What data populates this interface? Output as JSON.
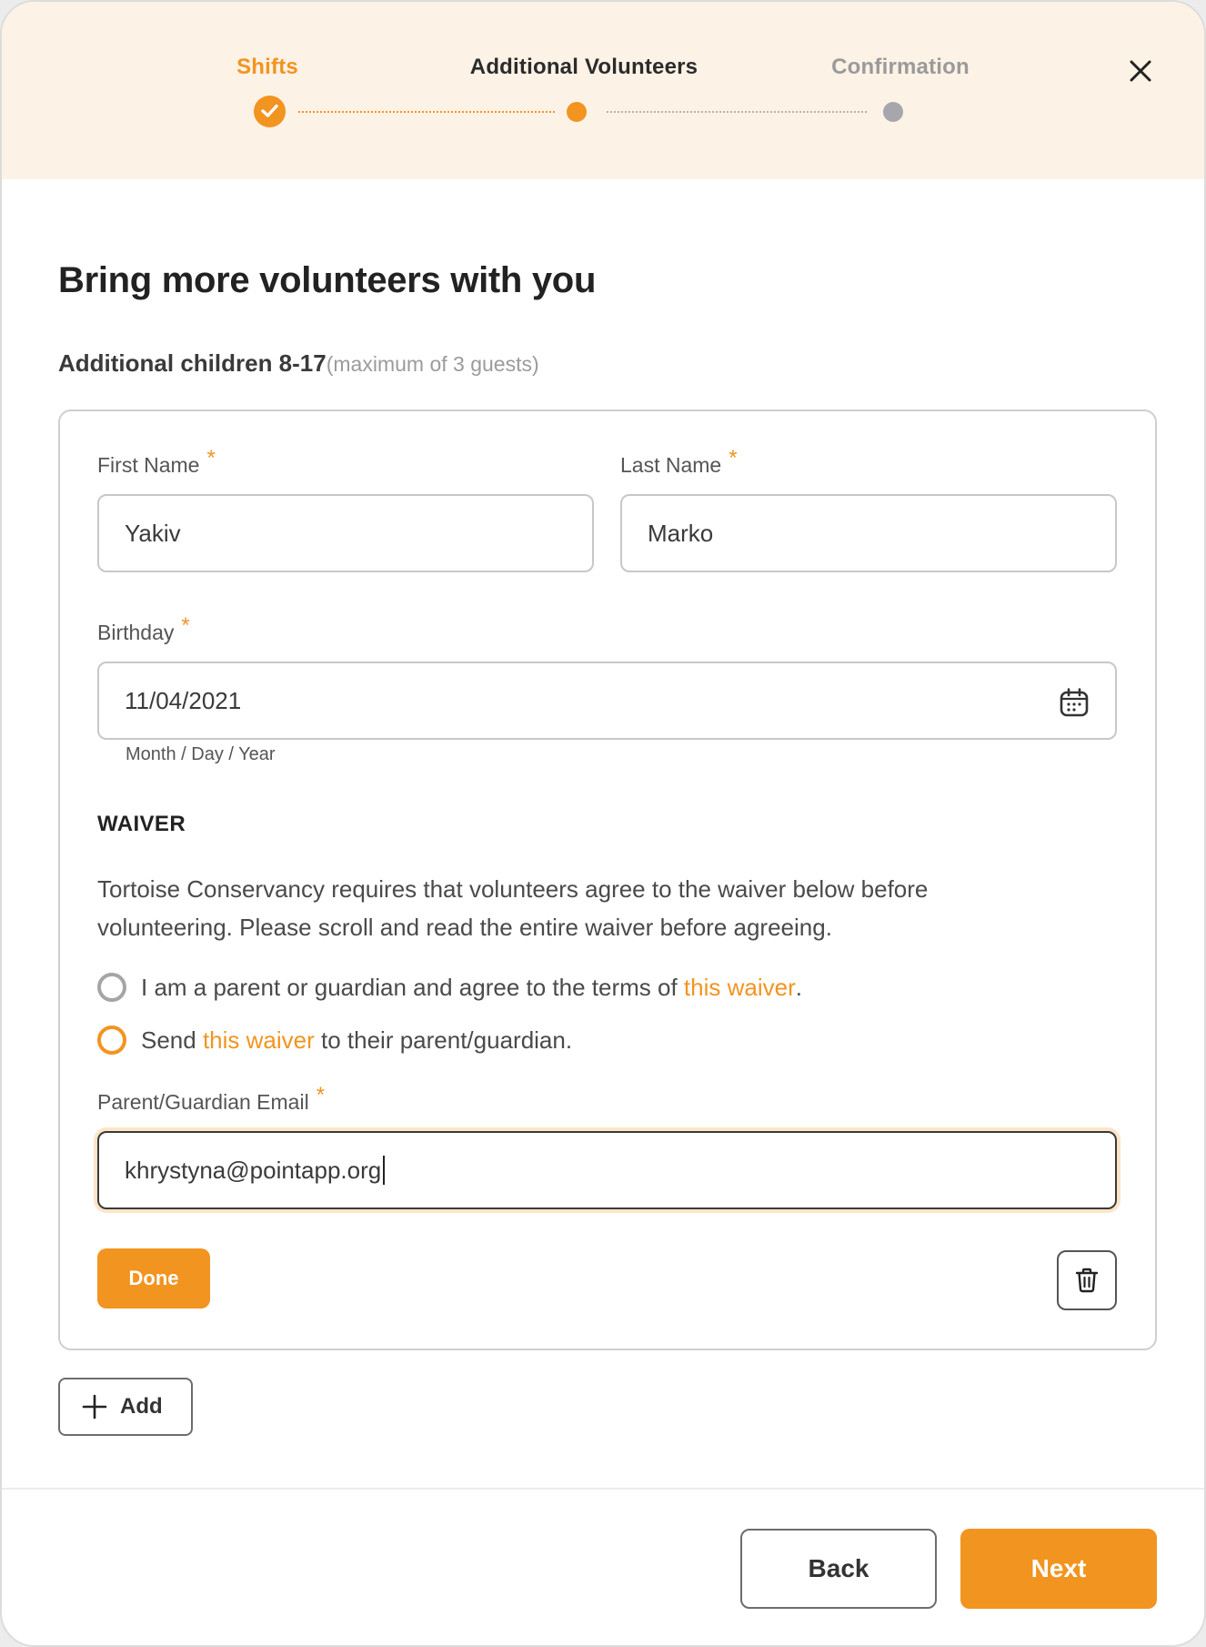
{
  "stepper": {
    "steps": [
      {
        "label": "Shifts",
        "state": "done"
      },
      {
        "label": "Additional Volunteers",
        "state": "active"
      },
      {
        "label": "Confirmation",
        "state": "pending"
      }
    ],
    "close_icon": "close-icon"
  },
  "page": {
    "title": "Bring more volunteers with you",
    "section_label": "Additional children 8-17",
    "section_hint": "(maximum of 3 guests)"
  },
  "form": {
    "first_name": {
      "label": "First Name",
      "value": "Yakiv",
      "required_mark": "*"
    },
    "last_name": {
      "label": "Last Name",
      "value": "Marko",
      "required_mark": "*"
    },
    "birthday": {
      "label": "Birthday",
      "value": "11/04/2021",
      "helper": "Month / Day / Year",
      "required_mark": "*",
      "icon": "calendar-icon"
    },
    "waiver": {
      "heading": "WAIVER",
      "description": "Tortoise Conservancy requires that volunteers agree to the waiver below before volunteering. Please scroll and read the entire waiver before agreeing.",
      "option_parent": {
        "before": "I am a parent or guardian and agree to the terms of ",
        "link": "this waiver",
        "after": "."
      },
      "option_send": {
        "before": "Send ",
        "link": "this waiver",
        "after": " to their parent/guardian."
      }
    },
    "guardian_email": {
      "label": "Parent/Guardian Email",
      "value": "khrystyna@pointapp.org",
      "required_mark": "*"
    },
    "done_label": "Done",
    "delete_icon": "trash-icon"
  },
  "actions": {
    "add_label": "Add",
    "back_label": "Back",
    "next_label": "Next"
  },
  "colors": {
    "accent": "#f29420",
    "header_bg": "#fdf2e6",
    "pending": "#a6a6ad"
  }
}
